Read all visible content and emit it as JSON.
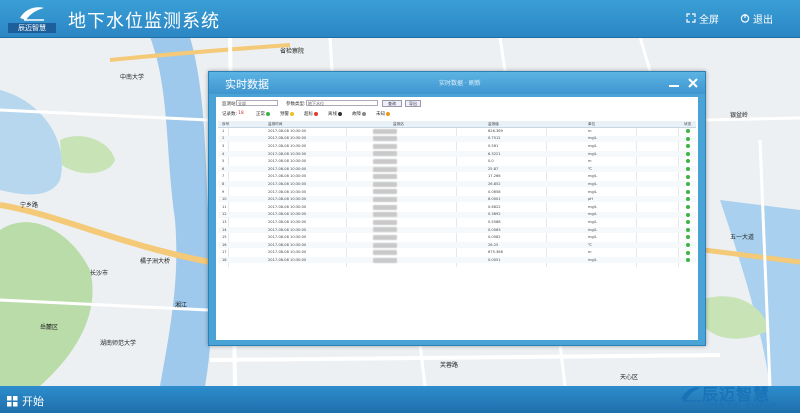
{
  "header": {
    "logo_text": "辰迈智慧",
    "title": "地下水位监测系统",
    "fullscreen_label": "全屏",
    "exit_label": "退出"
  },
  "map": {
    "labels": [
      "中南大学",
      "长沙市",
      "岳麓区",
      "橘子洲大桥",
      "湖南师范大学",
      "宁乡路",
      "省检察院",
      "芙蓉路",
      "湘江",
      "天心区",
      "银盆岭",
      "五一大道"
    ]
  },
  "dialog": {
    "title": "实时数据",
    "subtitle": "实时数据 · 刷新",
    "minimize_label": "—",
    "close_label": "✕",
    "toolbar": {
      "station_label": "监测站:",
      "station_value": "全部",
      "type_label": "参数类型:",
      "type_value": "地下水位",
      "query_button": "查询",
      "export_button": "导出",
      "legend": [
        {
          "label": "正常",
          "color": "#3cb540"
        },
        {
          "label": "预警",
          "color": "#f0c020"
        },
        {
          "label": "超标",
          "color": "#e03a2f"
        },
        {
          "label": "离线",
          "color": "#333333"
        },
        {
          "label": "故障",
          "color": "#888888"
        },
        {
          "label": "未知",
          "color": "#e89a1c"
        }
      ],
      "total_label": "记录数:",
      "total_value": "18"
    },
    "table": {
      "headers": [
        "序号",
        "监测时间",
        "监测站",
        "监测值",
        "单位",
        "状态"
      ],
      "rows": [
        {
          "no": "1",
          "time": "2017-08-08 10:30:00",
          "value": "826.369",
          "unit": "m"
        },
        {
          "no": "2",
          "time": "2017-08-08 10:30:00",
          "value": "0.7512",
          "unit": "mg/L"
        },
        {
          "no": "3",
          "time": "2017-08-08 10:30:00",
          "value": "0.581",
          "unit": "mg/L"
        },
        {
          "no": "4",
          "time": "2017-08-08 10:30:00",
          "value": "6.3221",
          "unit": "mg/L"
        },
        {
          "no": "5",
          "time": "2017-08-08 10:30:00",
          "value": "0.0",
          "unit": "m"
        },
        {
          "no": "6",
          "time": "2017-08-08 10:30:00",
          "value": "25.87",
          "unit": "℃"
        },
        {
          "no": "7",
          "time": "2017-08-08 10:30:00",
          "value": "17.266",
          "unit": "mg/L"
        },
        {
          "no": "8",
          "time": "2017-08-08 10:30:00",
          "value": "26.852",
          "unit": "mg/L"
        },
        {
          "no": "9",
          "time": "2017-08-08 10:30:00",
          "value": "0.0658",
          "unit": "mg/L"
        },
        {
          "no": "10",
          "time": "2017-08-08 10:30:00",
          "value": "6.0001",
          "unit": "pH"
        },
        {
          "no": "11",
          "time": "2017-08-08 10:30:00",
          "value": "0.6822",
          "unit": "mg/L"
        },
        {
          "no": "12",
          "time": "2017-08-08 10:30:00",
          "value": "0.3692",
          "unit": "mg/L"
        },
        {
          "no": "13",
          "time": "2017-08-08 10:30:00",
          "value": "0.5588",
          "unit": "mg/L"
        },
        {
          "no": "14",
          "time": "2017-08-08 10:30:00",
          "value": "0.0563",
          "unit": "mg/L"
        },
        {
          "no": "15",
          "time": "2017-08-08 10:30:00",
          "value": "0.0082",
          "unit": "mg/L"
        },
        {
          "no": "16",
          "time": "2017-08-08 10:30:00",
          "value": "26.25",
          "unit": "℃"
        },
        {
          "no": "17",
          "time": "2017-08-08 10:30:00",
          "value": "675.366",
          "unit": "m"
        },
        {
          "no": "18",
          "time": "2017-08-08 10:30:00",
          "value": "0.0051",
          "unit": "mg/L"
        }
      ]
    }
  },
  "footer": {
    "start_label": "开始",
    "brand_cn": "辰迈智慧",
    "brand_en": "CHEN MAI WISDOM"
  },
  "colors": {
    "topbar": "#3a9fd6",
    "dialog": "#4aa3d6",
    "river": "#9ec9ec",
    "status_ok": "#3cb540"
  },
  "icons": [
    "fullscreen-icon",
    "power-icon",
    "minimize-icon",
    "close-icon",
    "start-grid-icon",
    "logo-icon",
    "map-poi-icon"
  ]
}
